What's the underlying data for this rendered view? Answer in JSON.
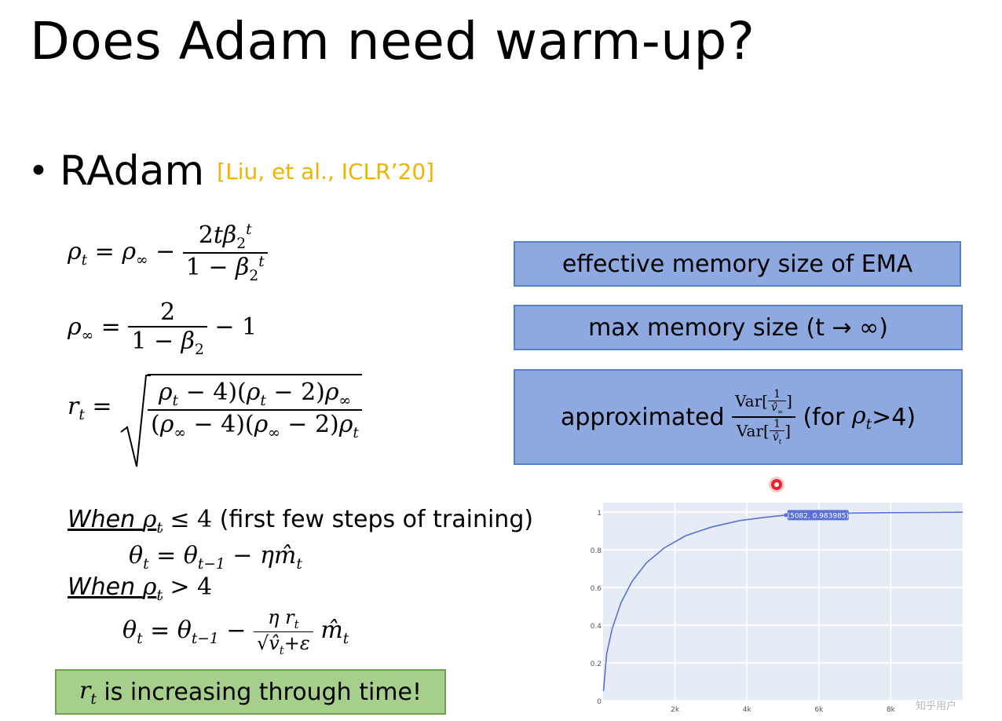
{
  "slide": {
    "title": "Does Adam need warm-up?",
    "bullet": "RAdam",
    "citation": "[Liu, et al., ICLR’20]"
  },
  "annotations": {
    "box1": "effective memory size of EMA",
    "box2": "max memory size (t → ∞)",
    "box3_prefix": "approximated",
    "box3_suffix": "(for",
    "box3_end": ">4)"
  },
  "conditions": {
    "when_label": "When",
    "cond1_text": "(first few steps of training)"
  },
  "highlight": {
    "suffix": "is increasing through time!"
  },
  "watermark": "知乎用户",
  "colors": {
    "blue_box": "#8ea9e0",
    "green_box": "#a7cf8c",
    "citation": "#f2b300",
    "curve": "#5b6fd6",
    "chart_bg": "#e5ecf6"
  },
  "chart_data": {
    "type": "line",
    "x_ticks": [
      "2k",
      "4k",
      "6k",
      "8k"
    ],
    "x_tick_values": [
      2000,
      4000,
      6000,
      8000
    ],
    "y_ticks": [
      "0",
      "0.2",
      "0.4",
      "0.6",
      "0.8",
      "1"
    ],
    "xlim": [
      0,
      10000
    ],
    "ylim": [
      0,
      1.05
    ],
    "grid": true,
    "tooltip": "(5082, 0.983985)",
    "tooltip_point": [
      5082,
      0.983985
    ],
    "series": [
      {
        "points": [
          [
            10,
            0.05
          ],
          [
            100,
            0.25
          ],
          [
            250,
            0.38
          ],
          [
            500,
            0.52
          ],
          [
            800,
            0.63
          ],
          [
            1200,
            0.73
          ],
          [
            1700,
            0.81
          ],
          [
            2300,
            0.875
          ],
          [
            3000,
            0.92
          ],
          [
            3800,
            0.955
          ],
          [
            4500,
            0.972
          ],
          [
            5082,
            0.983985
          ],
          [
            6000,
            0.991
          ],
          [
            7000,
            0.995
          ],
          [
            8000,
            0.997
          ],
          [
            9000,
            0.998
          ],
          [
            10000,
            0.999
          ]
        ]
      }
    ]
  }
}
